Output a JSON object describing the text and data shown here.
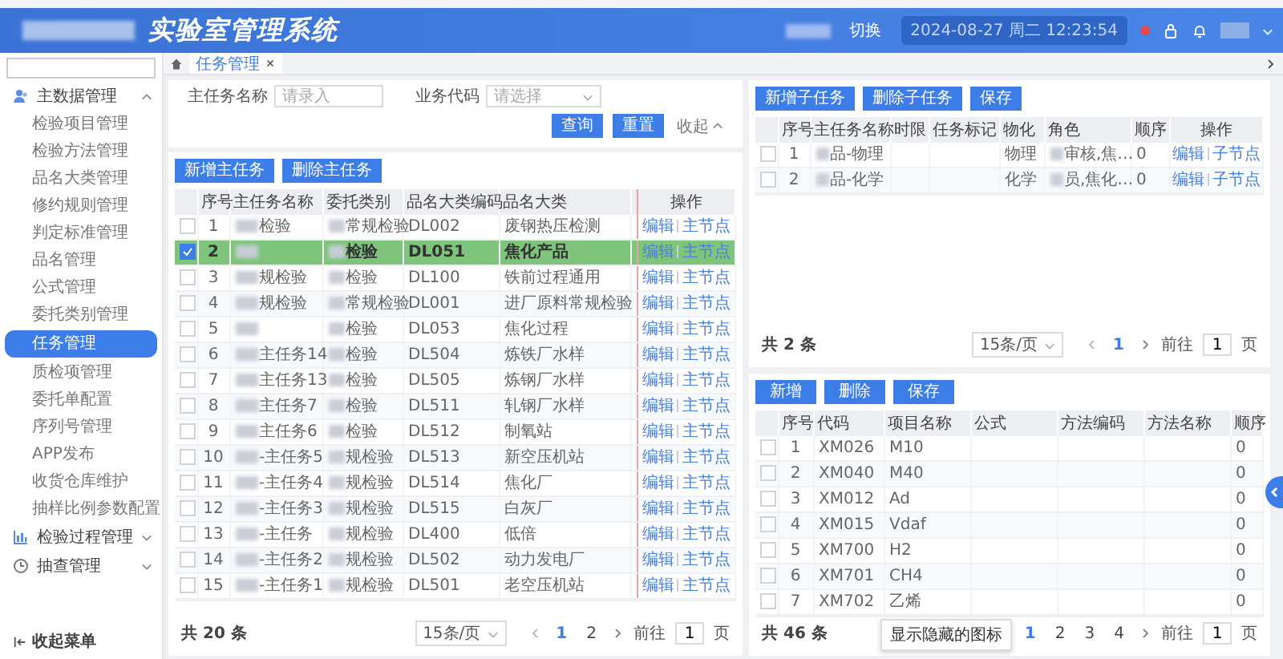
{
  "header": {
    "title": "实验室管理系统",
    "logo_masked": true,
    "user_masked": true,
    "switch": "切换",
    "datetime": "2024-08-27 周二 12:23:54",
    "alert": true
  },
  "sidebar": {
    "groups": [
      {
        "label": "主数据管理",
        "expanded": true,
        "children": [
          {
            "label": "检验项目管理",
            "selected": false
          },
          {
            "label": "检验方法管理",
            "selected": false
          },
          {
            "label": "品名大类管理",
            "selected": false
          },
          {
            "label": "修约规则管理",
            "selected": false
          },
          {
            "label": "判定标准管理",
            "selected": false
          },
          {
            "label": "品名管理",
            "selected": false
          },
          {
            "label": "公式管理",
            "selected": false
          },
          {
            "label": "委托类别管理",
            "selected": false
          },
          {
            "label": "任务管理",
            "selected": true
          },
          {
            "label": "质检项管理",
            "selected": false
          },
          {
            "label": "委托单配置",
            "selected": false
          },
          {
            "label": "序列号管理",
            "selected": false
          },
          {
            "label": "APP发布",
            "selected": false
          },
          {
            "label": "收货仓库维护",
            "selected": false
          },
          {
            "label": "抽样比例参数配置",
            "selected": false
          }
        ]
      },
      {
        "label": "检验过程管理",
        "expanded": false
      },
      {
        "label": "抽查管理",
        "expanded": false
      }
    ],
    "collapse_label": "收起菜单"
  },
  "tabs": [
    {
      "label": "任务管理",
      "selected": true
    }
  ],
  "search_form": {
    "fields": [
      {
        "label": "主任务名称",
        "kind": "input",
        "placeholder": "请录入"
      },
      {
        "label": "业务代码",
        "kind": "select",
        "placeholder": "请选择"
      }
    ],
    "buttons": [
      "查询",
      "重置"
    ],
    "collapse": "收起"
  },
  "main_panel": {
    "buttons": [
      "新增主任务",
      "删除主任务"
    ],
    "columns": [
      "序号",
      "主任务名称",
      "委托类别",
      "品名大类编码",
      "品名大类",
      "操作"
    ],
    "rows": [
      {
        "no": "1",
        "name": "检验",
        "name_masked": true,
        "category": "常规检验",
        "code": "DL002",
        "type": "废钢热压检测",
        "actions": [
          "编辑",
          "主节点"
        ],
        "selected": false,
        "checked": false
      },
      {
        "no": "2",
        "name_masked": true,
        "category": "检验",
        "code": "DL051",
        "type": "焦化产品",
        "actions": [
          "编辑",
          "主节点"
        ],
        "selected": true,
        "checked": true
      },
      {
        "no": "3",
        "name": "规检验",
        "name_masked": true,
        "category": "检验",
        "code": "DL100",
        "type": "铁前过程通用",
        "actions": [
          "编辑",
          "主节点"
        ],
        "selected": false,
        "checked": false
      },
      {
        "no": "4",
        "name": "规检验",
        "name_masked": true,
        "category": "常规检验",
        "code": "DL001",
        "type": "进厂原料常规检验",
        "actions": [
          "编辑",
          "主节点"
        ],
        "selected": false,
        "checked": false
      },
      {
        "no": "5",
        "name_masked": true,
        "category": "检验",
        "code": "DL053",
        "type": "焦化过程",
        "actions": [
          "编辑",
          "主节点"
        ],
        "selected": false,
        "checked": false
      },
      {
        "no": "6",
        "name": "主任务14",
        "name_masked": true,
        "category": "检验",
        "code": "DL504",
        "type": "炼铁厂水样",
        "actions": [
          "编辑",
          "主节点"
        ],
        "selected": false,
        "checked": false
      },
      {
        "no": "7",
        "name": "主任务13",
        "name_masked": true,
        "category": "检验",
        "code": "DL505",
        "type": "炼钢厂水样",
        "actions": [
          "编辑",
          "主节点"
        ],
        "selected": false,
        "checked": false
      },
      {
        "no": "8",
        "name": "主任务7",
        "name_masked": true,
        "category": "检验",
        "code": "DL511",
        "type": "轧钢厂水样",
        "actions": [
          "编辑",
          "主节点"
        ],
        "selected": false,
        "checked": false
      },
      {
        "no": "9",
        "name": "主任务6",
        "name_masked": true,
        "category": "检验",
        "code": "DL512",
        "type": "制氧站",
        "actions": [
          "编辑",
          "主节点"
        ],
        "selected": false,
        "checked": false
      },
      {
        "no": "10",
        "name": "-主任务5",
        "name_masked": true,
        "category": "规检验",
        "code": "DL513",
        "type": "新空压机站",
        "actions": [
          "编辑",
          "主节点"
        ],
        "selected": false,
        "checked": false
      },
      {
        "no": "11",
        "name": "-主任务4",
        "name_masked": true,
        "category": "规检验",
        "code": "DL514",
        "type": "焦化厂",
        "actions": [
          "编辑",
          "主节点"
        ],
        "selected": false,
        "checked": false
      },
      {
        "no": "12",
        "name": "-主任务3",
        "name_masked": true,
        "category": "规检验",
        "code": "DL515",
        "type": "白灰厂",
        "actions": [
          "编辑",
          "主节点"
        ],
        "selected": false,
        "checked": false
      },
      {
        "no": "13",
        "name": "-主任务",
        "name_masked": true,
        "category": "规检验",
        "code": "DL400",
        "type": "低倍",
        "actions": [
          "编辑",
          "主节点"
        ],
        "selected": false,
        "checked": false
      },
      {
        "no": "14",
        "name": "-主任务2",
        "name_masked": true,
        "category": "规检验",
        "code": "DL502",
        "type": "动力发电厂",
        "actions": [
          "编辑",
          "主节点"
        ],
        "selected": false,
        "checked": false
      },
      {
        "no": "15",
        "name": "-主任务1",
        "name_masked": true,
        "category": "规检验",
        "code": "DL501",
        "type": "老空压机站",
        "actions": [
          "编辑",
          "主节点"
        ],
        "selected": false,
        "checked": false
      }
    ],
    "pagination": {
      "total": "共 20 条",
      "page_size": "15条/页",
      "pages": [
        {
          "label": "1",
          "selected": true
        },
        {
          "label": "2",
          "selected": false
        }
      ],
      "goto_label": "前往",
      "goto_value": "1",
      "suffix": "页"
    }
  },
  "sub_panel": {
    "buttons": [
      "新增子任务",
      "删除子任务",
      "保存"
    ],
    "columns": [
      "序号",
      "主任务名称",
      "时限",
      "任务标记",
      "物化",
      "角色",
      "顺序",
      "操作"
    ],
    "rows": [
      {
        "no": "1",
        "name": "品-物理",
        "kind": "物理",
        "role": "审核,焦…",
        "order": "0",
        "actions": [
          "编辑",
          "子节点"
        ],
        "checked": false
      },
      {
        "no": "2",
        "name": "品-化学",
        "kind": "化学",
        "role": "员,焦化…",
        "order": "0",
        "actions": [
          "编辑",
          "子节点"
        ],
        "checked": false
      }
    ],
    "pagination": {
      "total": "共 2 条",
      "page_size": "15条/页",
      "pages": [
        {
          "label": "1",
          "selected": true
        }
      ],
      "goto_label": "前往",
      "goto_value": "1",
      "suffix": "页"
    }
  },
  "item_panel": {
    "buttons": [
      "新增",
      "删除",
      "保存"
    ],
    "columns": [
      "序号",
      "代码",
      "项目名称",
      "公式",
      "方法编码",
      "方法名称",
      "顺序"
    ],
    "rows": [
      {
        "no": "1",
        "code": "XM026",
        "name": "M10",
        "order": "0",
        "checked": false
      },
      {
        "no": "2",
        "code": "XM040",
        "name": "M40",
        "order": "0",
        "checked": false
      },
      {
        "no": "3",
        "code": "XM012",
        "name": "Ad",
        "order": "0",
        "checked": false
      },
      {
        "no": "4",
        "code": "XM015",
        "name": "Vdaf",
        "order": "0",
        "checked": false
      },
      {
        "no": "5",
        "code": "XM700",
        "name": "H2",
        "order": "0",
        "checked": false
      },
      {
        "no": "6",
        "code": "XM701",
        "name": "CH4",
        "order": "0",
        "checked": false
      },
      {
        "no": "7",
        "code": "XM702",
        "name": "乙烯",
        "order": "0",
        "checked": false
      }
    ],
    "pagination": {
      "total": "共 46 条",
      "pages": [
        {
          "label": "1",
          "selected": true
        },
        {
          "label": "2",
          "selected": false
        },
        {
          "label": "3",
          "selected": false
        },
        {
          "label": "4",
          "selected": false
        }
      ],
      "goto_label": "前往",
      "goto_value": "1",
      "suffix": "页"
    },
    "tooltip": "显示隐藏的图标"
  }
}
